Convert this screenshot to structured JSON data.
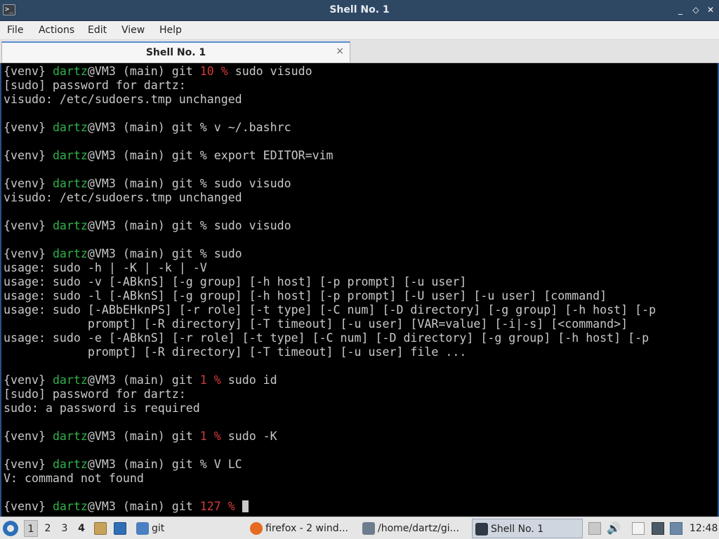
{
  "window": {
    "title": "Shell No. 1",
    "controls": [
      "_",
      "◇",
      "✕"
    ]
  },
  "menu": [
    "File",
    "Actions",
    "Edit",
    "View",
    "Help"
  ],
  "tab": {
    "label": "Shell No. 1",
    "close": "×"
  },
  "terminal": {
    "lines": [
      [
        {
          "t": "{venv} "
        },
        {
          "t": "dartz",
          "c": "user"
        },
        {
          "t": "@VM3 (main) git "
        },
        {
          "t": "10 %",
          "c": "err"
        },
        {
          "t": " sudo visudo"
        }
      ],
      [
        {
          "t": "[sudo] password for dartz:"
        }
      ],
      [
        {
          "t": "visudo: /etc/sudoers.tmp unchanged"
        }
      ],
      [],
      [
        {
          "t": "{venv} "
        },
        {
          "t": "dartz",
          "c": "user"
        },
        {
          "t": "@VM3 (main) git % v ~/.bashrc"
        }
      ],
      [],
      [
        {
          "t": "{venv} "
        },
        {
          "t": "dartz",
          "c": "user"
        },
        {
          "t": "@VM3 (main) git % export EDITOR=vim"
        }
      ],
      [],
      [
        {
          "t": "{venv} "
        },
        {
          "t": "dartz",
          "c": "user"
        },
        {
          "t": "@VM3 (main) git % sudo visudo"
        }
      ],
      [
        {
          "t": "visudo: /etc/sudoers.tmp unchanged"
        }
      ],
      [],
      [
        {
          "t": "{venv} "
        },
        {
          "t": "dartz",
          "c": "user"
        },
        {
          "t": "@VM3 (main) git % sudo visudo"
        }
      ],
      [],
      [
        {
          "t": "{venv} "
        },
        {
          "t": "dartz",
          "c": "user"
        },
        {
          "t": "@VM3 (main) git % sudo"
        }
      ],
      [
        {
          "t": "usage: sudo -h | -K | -k | -V"
        }
      ],
      [
        {
          "t": "usage: sudo -v [-ABknS] [-g group] [-h host] [-p prompt] [-u user]"
        }
      ],
      [
        {
          "t": "usage: sudo -l [-ABknS] [-g group] [-h host] [-p prompt] [-U user] [-u user] [command]"
        }
      ],
      [
        {
          "t": "usage: sudo [-ABbEHknPS] [-r role] [-t type] [-C num] [-D directory] [-g group] [-h host] [-p"
        }
      ],
      [
        {
          "t": "            prompt] [-R directory] [-T timeout] [-u user] [VAR=value] [-i|-s] [<command>]"
        }
      ],
      [
        {
          "t": "usage: sudo -e [-ABknS] [-r role] [-t type] [-C num] [-D directory] [-g group] [-h host] [-p"
        }
      ],
      [
        {
          "t": "            prompt] [-R directory] [-T timeout] [-u user] file ..."
        }
      ],
      [],
      [
        {
          "t": "{venv} "
        },
        {
          "t": "dartz",
          "c": "user"
        },
        {
          "t": "@VM3 (main) git "
        },
        {
          "t": "1 %",
          "c": "err"
        },
        {
          "t": " sudo id"
        }
      ],
      [
        {
          "t": "[sudo] password for dartz:"
        }
      ],
      [
        {
          "t": "sudo: a password is required"
        }
      ],
      [],
      [
        {
          "t": "{venv} "
        },
        {
          "t": "dartz",
          "c": "user"
        },
        {
          "t": "@VM3 (main) git "
        },
        {
          "t": "1 %",
          "c": "err"
        },
        {
          "t": " sudo -K"
        }
      ],
      [],
      [
        {
          "t": "{venv} "
        },
        {
          "t": "dartz",
          "c": "user"
        },
        {
          "t": "@VM3 (main) git % V LC"
        }
      ],
      [
        {
          "t": "V: command not found"
        }
      ],
      [],
      [
        {
          "t": "{venv} "
        },
        {
          "t": "dartz",
          "c": "user"
        },
        {
          "t": "@VM3 (main) git "
        },
        {
          "t": "127 %",
          "c": "err"
        },
        {
          "t": " "
        },
        {
          "cursor": true
        }
      ]
    ]
  },
  "taskbar": {
    "desktops": [
      "1",
      "2",
      "3",
      "4"
    ],
    "quicklaunch": [
      {
        "label": "git",
        "icon": "folder-icon"
      }
    ],
    "tasks": [
      {
        "label": "firefox - 2 wind...",
        "icon": "firefox-icon"
      },
      {
        "label": "/home/dartz/gi...",
        "icon": "editor-icon"
      },
      {
        "label": "Shell No. 1",
        "icon": "terminal-icon"
      }
    ],
    "clock": "12:48"
  },
  "colors": {
    "titlebar": "#2e4763",
    "prompt_user": "#2fb24a",
    "prompt_error": "#d23a3a",
    "terminal_text": "#c9c9c9"
  }
}
